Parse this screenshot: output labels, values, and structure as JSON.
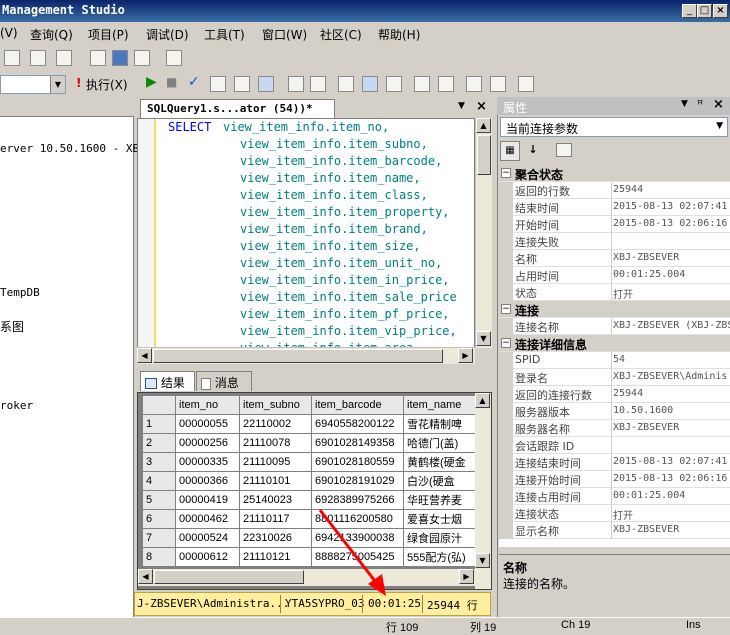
{
  "window": {
    "title": "Microsoft SQL Server Management Studio",
    "title_visible": "Management Studio"
  },
  "menu": [
    "(V)",
    "查询(Q)",
    "项目(P)",
    "调试(D)",
    "工具(T)",
    "窗口(W)",
    "社区(C)",
    "帮助(H)"
  ],
  "toolbar": {
    "execute_label": "执行(X)"
  },
  "object_explorer": {
    "server": "erver 10.50.1600 - XBJ",
    "items": [
      "TempDB",
      "系图",
      "roker"
    ]
  },
  "editor": {
    "tab_label": "SQLQuery1.s...ator (54))*",
    "keyword": "SELECT",
    "lines": [
      "view_item_info.item_no,",
      "view_item_info.item_subno,",
      "view_item_info.item_barcode,",
      "view_item_info.item_name,",
      "view_item_info.item_class,",
      "view_item_info.item_property,",
      "view_item_info.item_brand,",
      "view_item_info.item_size,",
      "view_item_info.item_unit_no,",
      "view_item_info.item_in_price,",
      "view_item_info.item_sale_price",
      "view_item_info.item_pf_price,",
      "view_item_info.item_vip_price,",
      "view_item_info.item_area"
    ]
  },
  "results": {
    "tabs": [
      "结果",
      "消息"
    ],
    "columns": [
      "item_no",
      "item_subno",
      "item_barcode",
      "item_name"
    ],
    "rows": [
      {
        "n": "1",
        "cells": [
          "00000055",
          "22110002",
          "6940558200122",
          "雪花精制啤"
        ]
      },
      {
        "n": "2",
        "cells": [
          "00000256",
          "21110078",
          "6901028149358",
          "哈德门(盖)"
        ]
      },
      {
        "n": "3",
        "cells": [
          "00000335",
          "21110095",
          "6901028180559",
          "黄鹤楼(硬金"
        ]
      },
      {
        "n": "4",
        "cells": [
          "00000366",
          "21110101",
          "6901028191029",
          "白沙(硬盒"
        ]
      },
      {
        "n": "5",
        "cells": [
          "00000419",
          "25140023",
          "6928389975266",
          "华旺营养麦"
        ]
      },
      {
        "n": "6",
        "cells": [
          "00000462",
          "21110117",
          "8801116200580",
          "爱喜女士烟"
        ]
      },
      {
        "n": "7",
        "cells": [
          "00000524",
          "22310026",
          "6942133900038",
          "绿食园原汁"
        ]
      },
      {
        "n": "8",
        "cells": [
          "00000612",
          "21110121",
          "8888275005425",
          "555配方(弘)"
        ]
      }
    ]
  },
  "statusbar": {
    "connection": "J-ZBSEVER\\Administra...",
    "user": "YTA5SYPRO_03",
    "elapsed": "00:01:25",
    "rows": "25944 行"
  },
  "bottom_status": {
    "line": "行 109",
    "col": "列 19",
    "ch": "Ch 19",
    "mode": "Ins"
  },
  "properties": {
    "header": "属性",
    "dropdown": "当前连接参数",
    "sections": [
      {
        "title": "聚合状态",
        "rows": [
          {
            "name": "返回的行数",
            "value": "25944"
          },
          {
            "name": "结束时间",
            "value": "2015-08-13 02:07:41"
          },
          {
            "name": "开始时间",
            "value": "2015-08-13 02:06:16"
          },
          {
            "name": "连接失败",
            "value": ""
          },
          {
            "name": "名称",
            "value": "XBJ-ZBSEVER"
          },
          {
            "name": "占用时间",
            "value": "00:01:25.004"
          },
          {
            "name": "状态",
            "value": "打开"
          }
        ]
      },
      {
        "title": "连接",
        "rows": [
          {
            "name": "连接名称",
            "value": "XBJ-ZBSEVER (XBJ-ZBS"
          }
        ]
      },
      {
        "title": "连接详细信息",
        "rows": [
          {
            "name": "SPID",
            "value": "54"
          },
          {
            "name": "登录名",
            "value": "XBJ-ZBSEVER\\Adminis"
          },
          {
            "name": "返回的连接行数",
            "value": "25944"
          },
          {
            "name": "服务器版本",
            "value": "10.50.1600"
          },
          {
            "name": "服务器名称",
            "value": "XBJ-ZBSEVER"
          },
          {
            "name": "会话跟踪 ID",
            "value": ""
          },
          {
            "name": "连接结束时间",
            "value": "2015-08-13 02:07:41"
          },
          {
            "name": "连接开始时间",
            "value": "2015-08-13 02:06:16"
          },
          {
            "name": "连接占用时间",
            "value": "00:01:25.004"
          },
          {
            "name": "连接状态",
            "value": "打开"
          },
          {
            "name": "显示名称",
            "value": "XBJ-ZBSEVER"
          }
        ]
      }
    ],
    "desc_title": "名称",
    "desc_text": "连接的名称。"
  },
  "colors": {
    "arrow": "#ff0000",
    "status_bg": "#ffef9e",
    "keyword": "#0000ff",
    "identifier": "#008080"
  }
}
